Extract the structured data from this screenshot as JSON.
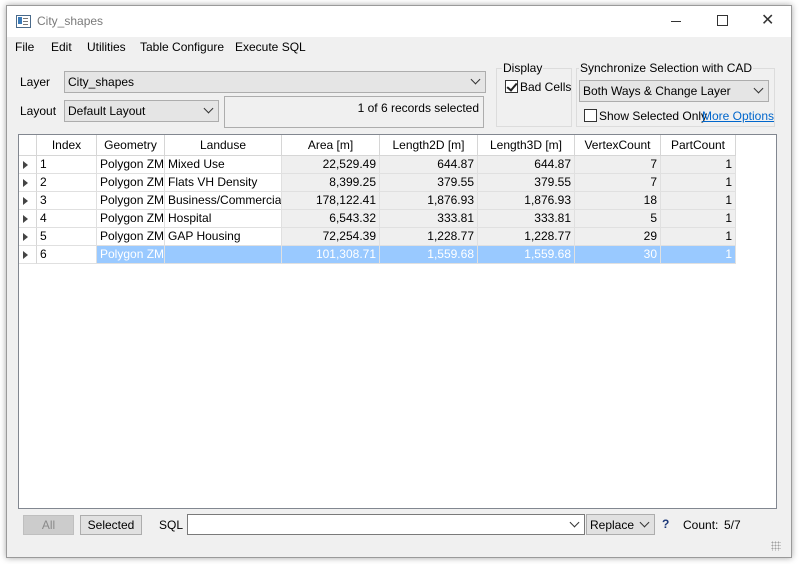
{
  "window": {
    "title": "City_shapes"
  },
  "menu": [
    "File",
    "Edit",
    "Utilities",
    "Table Configure",
    "Execute SQL"
  ],
  "layer": {
    "label": "Layer",
    "value": "City_shapes"
  },
  "layout": {
    "label": "Layout",
    "value": "Default Layout"
  },
  "status": "1 of 6 records selected",
  "display": {
    "title": "Display",
    "bad_cells_label": "Bad Cells"
  },
  "sync": {
    "title": "Synchronize Selection with CAD",
    "value": "Both Ways & Change Layer",
    "show_selected_label": "Show Selected Only",
    "more_options": "More Options"
  },
  "table": {
    "columns": [
      "Index",
      "Geometry",
      "Landuse",
      "Area [m]",
      "Length2D [m]",
      "Length3D [m]",
      "VertexCount",
      "PartCount"
    ],
    "rows": [
      [
        "1",
        "Polygon ZM",
        "Mixed Use",
        "22,529.49",
        "644.87",
        "644.87",
        "7",
        "1"
      ],
      [
        "2",
        "Polygon ZM",
        "Flats VH Density",
        "8,399.25",
        "379.55",
        "379.55",
        "7",
        "1"
      ],
      [
        "3",
        "Polygon ZM",
        "Business/Commercial",
        "178,122.41",
        "1,876.93",
        "1,876.93",
        "18",
        "1"
      ],
      [
        "4",
        "Polygon ZM",
        "Hospital",
        "6,543.32",
        "333.81",
        "333.81",
        "5",
        "1"
      ],
      [
        "5",
        "Polygon ZM",
        "GAP Housing",
        "72,254.39",
        "1,228.77",
        "1,228.77",
        "29",
        "1"
      ],
      [
        "6",
        "Polygon ZM",
        "",
        "101,308.71",
        "1,559.68",
        "1,559.68",
        "30",
        "1"
      ]
    ],
    "selected_row": 5
  },
  "bottom": {
    "all_label": "All",
    "selected_label": "Selected",
    "sql_label": "SQL",
    "sql_value": "",
    "replace_value": "Replace",
    "help": "?",
    "count_label": "Count:",
    "count_value": "5/7"
  },
  "icons": {
    "app": "table-window-icon",
    "minimize": "minimize-icon",
    "maximize": "maximize-icon",
    "close": "close-icon",
    "row_indicator": "triangle-right-icon",
    "dropdown": "chevron-down-icon",
    "help": "question-mark-icon"
  },
  "colors": {
    "selection": "#99c9ff",
    "link": "#0066cc",
    "numeric_cell_bg": "#efefef"
  }
}
